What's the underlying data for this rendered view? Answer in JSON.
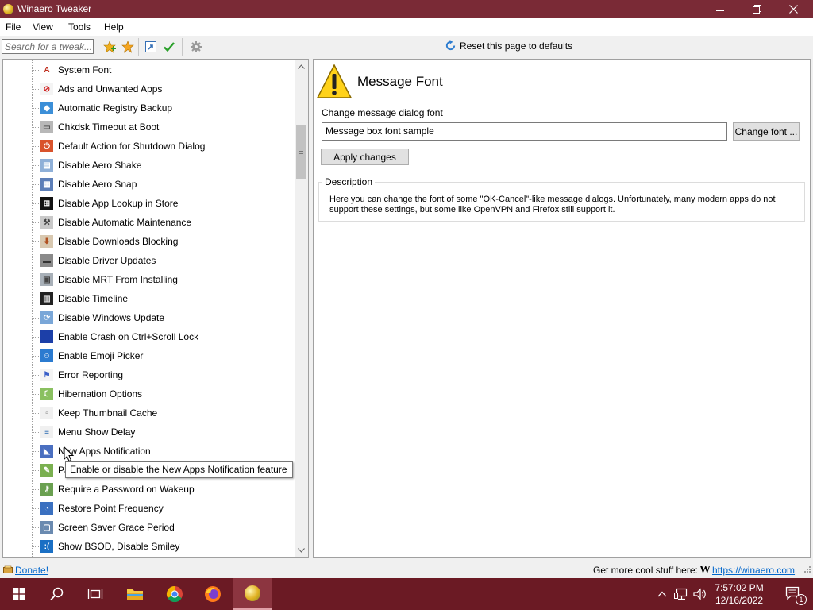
{
  "window": {
    "title": "Winaero Tweaker"
  },
  "menu": [
    "File",
    "View",
    "Tools",
    "Help"
  ],
  "toolbar": {
    "search_placeholder": "Search for a tweak...",
    "reset_label": "Reset this page to defaults"
  },
  "tree": {
    "items": [
      {
        "label": "System Font",
        "icon": "letter-a-icon"
      },
      {
        "label": "Ads and Unwanted Apps",
        "icon": "no-ads-icon"
      },
      {
        "label": "Automatic Registry Backup",
        "icon": "registry-icon"
      },
      {
        "label": "Chkdsk Timeout at Boot",
        "icon": "disk-icon"
      },
      {
        "label": "Default Action for Shutdown Dialog",
        "icon": "power-icon"
      },
      {
        "label": "Disable Aero Shake",
        "icon": "aero-shake-icon"
      },
      {
        "label": "Disable Aero Snap",
        "icon": "aero-snap-icon"
      },
      {
        "label": "Disable App Lookup in Store",
        "icon": "store-icon"
      },
      {
        "label": "Disable Automatic Maintenance",
        "icon": "maintenance-icon"
      },
      {
        "label": "Disable Downloads Blocking",
        "icon": "download-icon"
      },
      {
        "label": "Disable Driver Updates",
        "icon": "driver-icon"
      },
      {
        "label": "Disable MRT From Installing",
        "icon": "mrt-icon"
      },
      {
        "label": "Disable Timeline",
        "icon": "timeline-icon"
      },
      {
        "label": "Disable Windows Update",
        "icon": "windows-update-icon"
      },
      {
        "label": "Enable Crash on Ctrl+Scroll Lock",
        "icon": "crash-icon"
      },
      {
        "label": "Enable Emoji Picker",
        "icon": "emoji-icon"
      },
      {
        "label": "Error Reporting",
        "icon": "error-flag-icon"
      },
      {
        "label": "Hibernation Options",
        "icon": "hibernation-icon"
      },
      {
        "label": "Keep Thumbnail Cache",
        "icon": "thumbnail-icon"
      },
      {
        "label": "Menu Show Delay",
        "icon": "menu-delay-icon"
      },
      {
        "label": "New Apps Notification",
        "icon": "notification-icon"
      },
      {
        "label": "Password Reveal Button",
        "icon": "password-icon"
      },
      {
        "label": "Require a Password on Wakeup",
        "icon": "wakeup-icon"
      },
      {
        "label": "Restore Point Frequency",
        "icon": "restore-icon"
      },
      {
        "label": "Screen Saver Grace Period",
        "icon": "screensaver-icon"
      },
      {
        "label": "Show BSOD, Disable Smiley",
        "icon": "bsod-icon"
      }
    ]
  },
  "page": {
    "title": "Message Font",
    "change_label": "Change message dialog font",
    "font_sample": "Message box font sample",
    "change_font_button": "Change font ...",
    "apply_button": "Apply changes",
    "description_legend": "Description",
    "description_text": "Here you can change the font of some \"OK-Cancel\"-like message dialogs. Unfortunately, many modern apps do not support these settings, but some like OpenVPN and Firefox still support it."
  },
  "tooltip": "Enable or disable the New Apps Notification feature",
  "status": {
    "donate": "Donate!",
    "promo": "Get more cool stuff here:",
    "logo": "W",
    "link": "https://winaero.com"
  },
  "taskbar": {
    "time": "7:57:02 PM",
    "date": "12/16/2022",
    "notification_count": "1"
  },
  "colors": {
    "titlebar": "#7a2a36",
    "taskbar": "#6b1a24",
    "link": "#0066cc"
  }
}
